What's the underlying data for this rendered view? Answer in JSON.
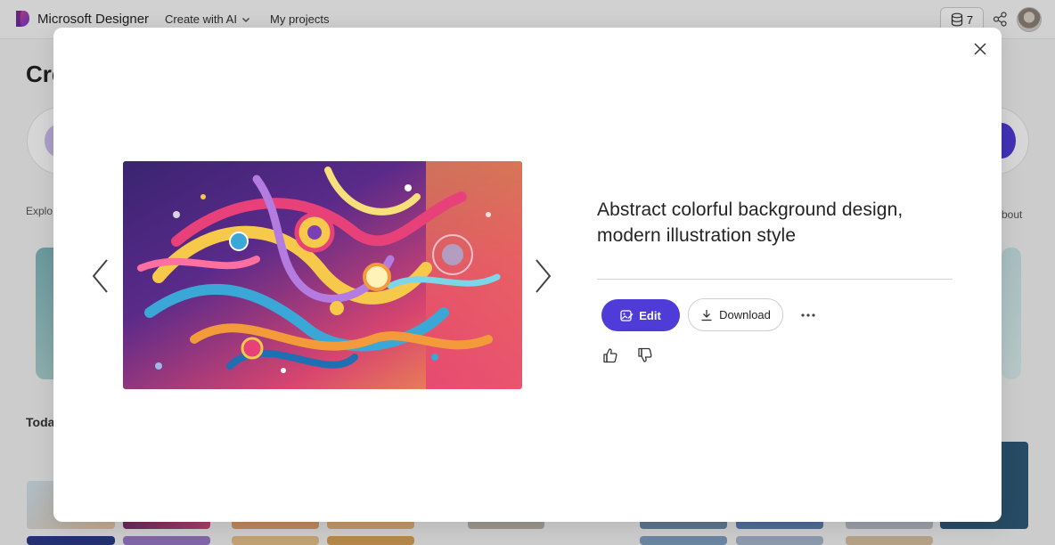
{
  "app": {
    "name": "Microsoft Designer",
    "nav": [
      {
        "label": "Create with AI",
        "has_dropdown": true
      },
      {
        "label": "My projects",
        "has_dropdown": false
      }
    ],
    "credits": "7",
    "icons": {
      "logo": "designer-logo-icon",
      "credits": "database-coin-icon",
      "share": "share-network-icon",
      "avatar": "user-avatar"
    },
    "brand_colors": {
      "primary": "#4f3bd8",
      "logo_gradient": [
        "#e04686",
        "#6c3bd8"
      ]
    }
  },
  "background": {
    "title": "Cre",
    "explore": "Explo",
    "about": "bout",
    "today": "Toda"
  },
  "modal": {
    "caption": "Abstract colorful background design, modern illustration style",
    "actions": {
      "edit_label": "Edit",
      "download_label": "Download",
      "more_icon": "more-horizontal-icon"
    },
    "feedback": {
      "like_icon": "thumbs-up-icon",
      "dislike_icon": "thumbs-down-icon"
    },
    "navigation": {
      "prev_icon": "chevron-left-icon",
      "next_icon": "chevron-right-icon",
      "close_icon": "close-icon"
    },
    "image": {
      "subject": "abstract colorful swirls illustration",
      "palette": [
        "#2a1a5e",
        "#e8417a",
        "#f39a3a",
        "#f6c94a",
        "#3aa7d6",
        "#7b3fb5"
      ]
    }
  }
}
